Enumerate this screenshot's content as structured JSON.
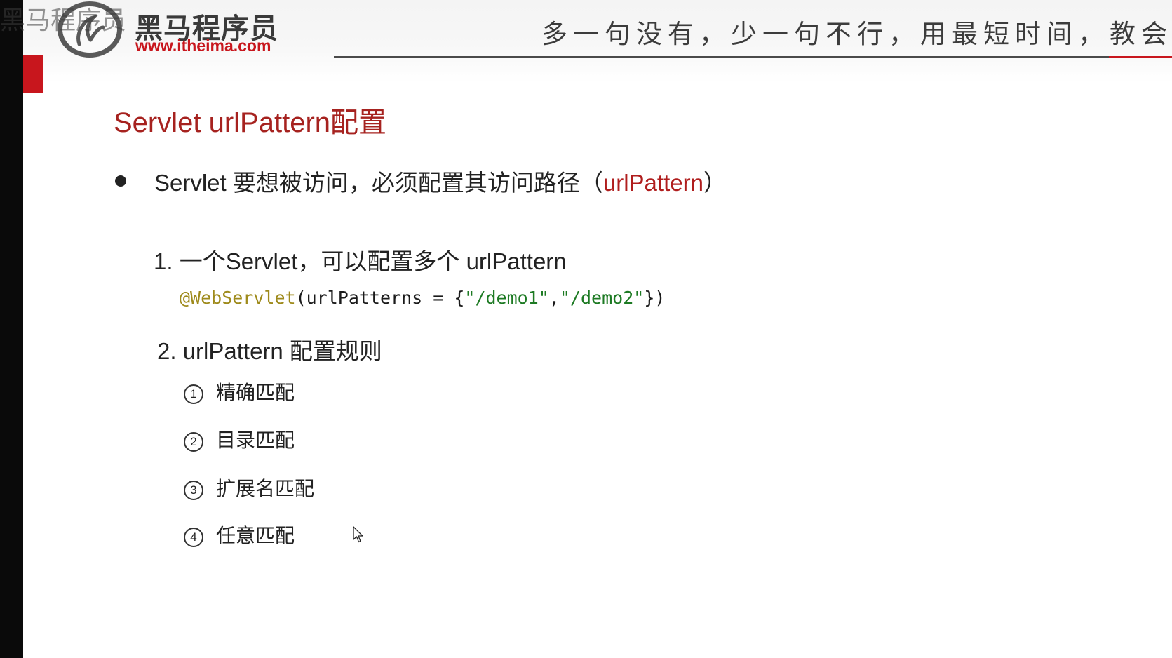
{
  "header": {
    "logo_text": "黑马程序员",
    "logo_url": "www.itheima.com",
    "overlay_text": "黑马程序员",
    "slogan": "多一句没有，少一句不行，用最短时间，教会最"
  },
  "slide": {
    "title": "Servlet urlPattern配置",
    "bullet": {
      "text": "Servlet 要想被访问，必须配置其访问路径（",
      "highlight": "urlPattern",
      "close": "）"
    },
    "item1": "1.  一个Servlet，可以配置多个 urlPattern",
    "code": {
      "annotation": "@WebServlet",
      "part1": "(urlPatterns = {",
      "str1": "\"/demo1\"",
      "comma": ",",
      "str2": "\"/demo2\"",
      "part2": "})"
    },
    "item2": "2. urlPattern 配置规则",
    "rules": [
      {
        "num": "1",
        "label": "精确匹配"
      },
      {
        "num": "2",
        "label": "目录匹配"
      },
      {
        "num": "3",
        "label": "扩展名匹配"
      },
      {
        "num": "4",
        "label": "任意匹配"
      }
    ]
  }
}
